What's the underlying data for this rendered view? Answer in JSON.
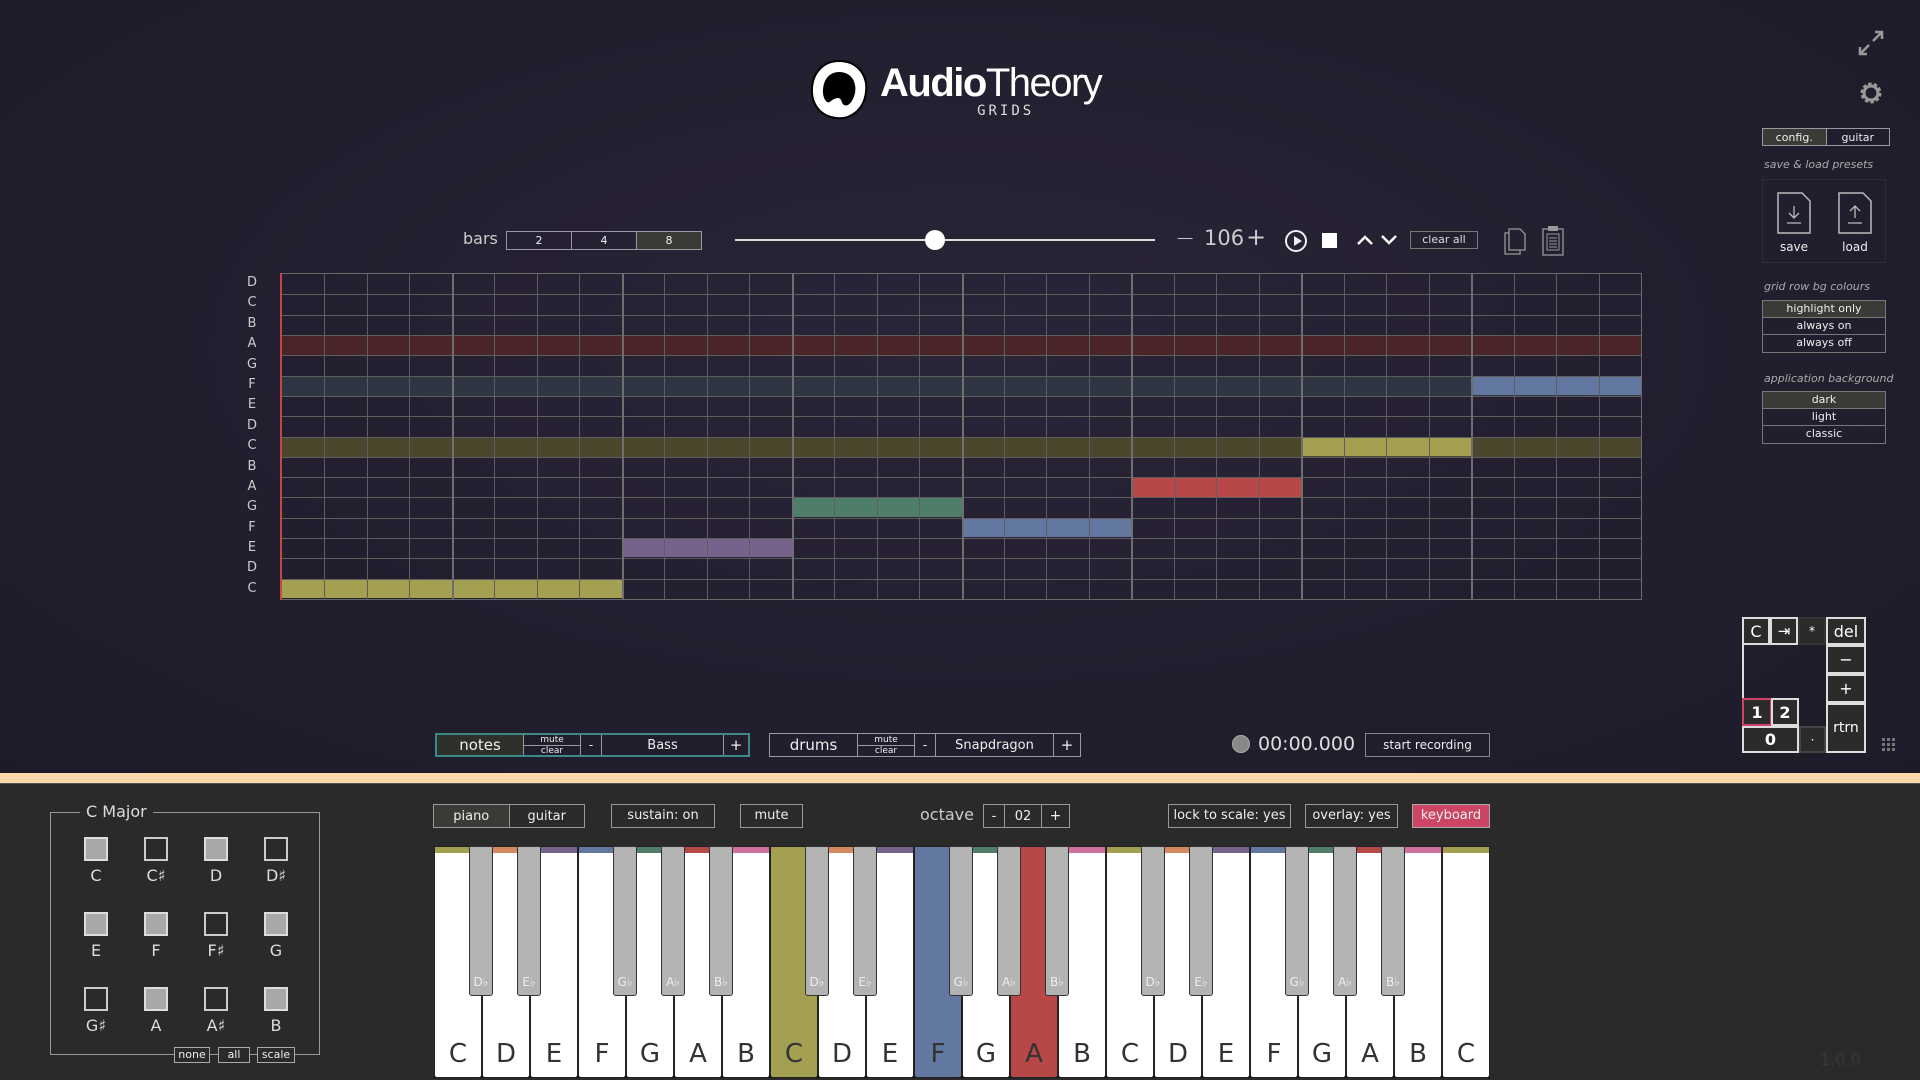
{
  "app": {
    "logo_title_bold": "Audio",
    "logo_title_rest": "Theory",
    "logo_subtitle": "GRIDS",
    "version": "1.0.0"
  },
  "colors": {
    "C": "#a3a052",
    "D": "#d4895e",
    "E": "#76628c",
    "F": "#6278a0",
    "G": "#4e7e6a",
    "A": "#b84848",
    "B": "#d070a0",
    "separator": "#fbd9a8",
    "keyboard_active": "#cc4562",
    "track_active_border": "#3b8a86"
  },
  "transport": {
    "bars_label": "bars",
    "bars_options": [
      "2",
      "4",
      "8"
    ],
    "bars_selected": "8",
    "position_fraction": 0.476,
    "tempo_minus": "−",
    "tempo": "106",
    "tempo_plus": "+",
    "clear_all": "clear all"
  },
  "grid": {
    "row_labels": [
      "D",
      "C",
      "B",
      "A",
      "G",
      "F",
      "E",
      "D",
      "C",
      "B",
      "A",
      "G",
      "F",
      "E",
      "D",
      "C"
    ],
    "columns": 32,
    "highlight_rows": [
      {
        "row": 3,
        "color": "#4a2428"
      },
      {
        "row": 5,
        "color": "#2f3542"
      },
      {
        "row": 8,
        "color": "#4a472c"
      }
    ],
    "notes": [
      {
        "pitch": "C",
        "row": 15,
        "start": 0,
        "length": 8,
        "color": "#a3a052"
      },
      {
        "pitch": "E",
        "row": 13,
        "start": 8,
        "length": 4,
        "color": "#76628c"
      },
      {
        "pitch": "G",
        "row": 11,
        "start": 12,
        "length": 4,
        "color": "#4e7e6a"
      },
      {
        "pitch": "F",
        "row": 12,
        "start": 16,
        "length": 4,
        "color": "#6278a0"
      },
      {
        "pitch": "A",
        "row": 10,
        "start": 20,
        "length": 4,
        "color": "#b84848"
      },
      {
        "pitch": "C",
        "row": 8,
        "start": 24,
        "length": 4,
        "color": "#a3a052"
      },
      {
        "pitch": "F",
        "row": 5,
        "start": 28,
        "length": 4,
        "color": "#6278a0"
      }
    ]
  },
  "tracks": [
    {
      "name": "notes",
      "mute": "mute",
      "clear": "clear",
      "minus": "-",
      "instrument": "Bass",
      "plus": "+",
      "active": true
    },
    {
      "name": "drums",
      "mute": "mute",
      "clear": "clear",
      "minus": "-",
      "instrument": "Snapdragon",
      "plus": "+",
      "active": false
    }
  ],
  "recording": {
    "time": "00:00.000",
    "button": "start recording"
  },
  "right_panel": {
    "tabs": [
      "config.",
      "guitar"
    ],
    "tab_selected": "config.",
    "presets_caption": "save & load presets",
    "save": "save",
    "load": "load",
    "row_bg_caption": "grid row bg colours",
    "row_bg_options": [
      "highlight only",
      "always on",
      "always off"
    ],
    "row_bg_selected": "highlight only",
    "app_bg_caption": "application background",
    "app_bg_options": [
      "dark",
      "light",
      "classic"
    ],
    "app_bg_selected": "dark"
  },
  "keypad": {
    "clear": "C",
    "skip": "⇥",
    "star": "*",
    "del": "del",
    "minus": "−",
    "plus": "+",
    "one": "1",
    "two": "2",
    "zero": "0",
    "dot": "·",
    "return": "rtrn",
    "selected": "1"
  },
  "scale": {
    "title": "C Major",
    "notes": [
      {
        "name": "C",
        "on": true
      },
      {
        "name": "C♯",
        "on": false
      },
      {
        "name": "D",
        "on": true
      },
      {
        "name": "D♯",
        "on": false
      },
      {
        "name": "E",
        "on": true
      },
      {
        "name": "F",
        "on": true
      },
      {
        "name": "F♯",
        "on": false
      },
      {
        "name": "G",
        "on": true
      },
      {
        "name": "G♯",
        "on": false
      },
      {
        "name": "A",
        "on": true
      },
      {
        "name": "A♯",
        "on": false
      },
      {
        "name": "B",
        "on": true
      }
    ],
    "buttons": [
      "none",
      "all",
      "scale"
    ]
  },
  "instrument_controls": {
    "instruments": [
      "piano",
      "guitar"
    ],
    "instrument_selected": "piano",
    "sustain": "sustain: on",
    "mute": "mute",
    "octave_label": "octave",
    "octave_minus": "-",
    "octave_value": "02",
    "octave_plus": "+",
    "lock_to_scale": "lock to scale: yes",
    "overlay": "overlay: yes",
    "keyboard": "keyboard"
  },
  "keyboard": {
    "white_keys": [
      "C",
      "D",
      "E",
      "F",
      "G",
      "A",
      "B",
      "C",
      "D",
      "E",
      "F",
      "G",
      "A",
      "B",
      "C",
      "D",
      "E",
      "F",
      "G",
      "A",
      "B",
      "C"
    ],
    "black_keys": [
      "D♭",
      "E♭",
      "G♭",
      "A♭",
      "B♭",
      "D♭",
      "E♭",
      "G♭",
      "A♭",
      "B♭",
      "D♭",
      "E♭",
      "G♭",
      "A♭",
      "B♭"
    ],
    "pressed": [
      {
        "index": 7,
        "note": "C"
      },
      {
        "index": 10,
        "note": "F"
      },
      {
        "index": 12,
        "note": "A"
      }
    ]
  }
}
